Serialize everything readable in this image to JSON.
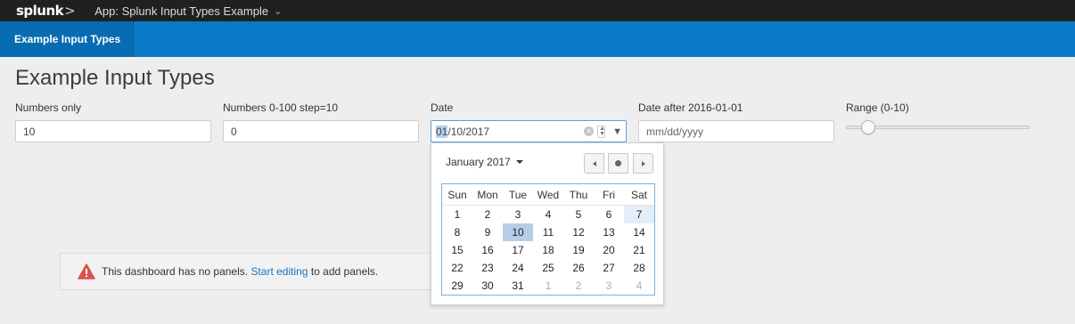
{
  "topbar": {
    "logo": "splunk",
    "logo_suffix": ">",
    "app_menu": "App: Splunk Input Types Example"
  },
  "nav": {
    "tab": "Example Input Types"
  },
  "page": {
    "title": "Example Input Types"
  },
  "inputs": {
    "numbers_only": {
      "label": "Numbers only",
      "value": "10"
    },
    "numbers_step": {
      "label": "Numbers 0-100 step=10",
      "value": "0"
    },
    "date": {
      "label": "Date",
      "value_month": "01",
      "value_rest": "/10/2017"
    },
    "date_after": {
      "label": "Date after 2016-01-01",
      "placeholder": "mm/dd/yyyy"
    },
    "range": {
      "label": "Range (0-10)",
      "value": 1,
      "min": 0,
      "max": 10
    }
  },
  "alert": {
    "text_before": "This dashboard has no panels.",
    "link": "Start editing",
    "text_after": "to add panels."
  },
  "datepicker": {
    "month_label": "January 2017",
    "weekdays": [
      "Sun",
      "Mon",
      "Tue",
      "Wed",
      "Thu",
      "Fri",
      "Sat"
    ],
    "weeks": [
      [
        "1",
        "2",
        "3",
        "4",
        "5",
        "6",
        "7"
      ],
      [
        "8",
        "9",
        "10",
        "11",
        "12",
        "13",
        "14"
      ],
      [
        "15",
        "16",
        "17",
        "18",
        "19",
        "20",
        "21"
      ],
      [
        "22",
        "23",
        "24",
        "25",
        "26",
        "27",
        "28"
      ],
      [
        "29",
        "30",
        "31",
        "1",
        "2",
        "3",
        "4"
      ]
    ],
    "muted_from_week5_index": 3,
    "selected_day": "10",
    "today_day": "7"
  },
  "colors": {
    "topbar": "#202020",
    "navbar": "#0a7ac8",
    "nav_tab_active": "#086cb2",
    "link": "#1a73c1",
    "warning": "#d9534f",
    "selected_day": "#b8cee6"
  }
}
